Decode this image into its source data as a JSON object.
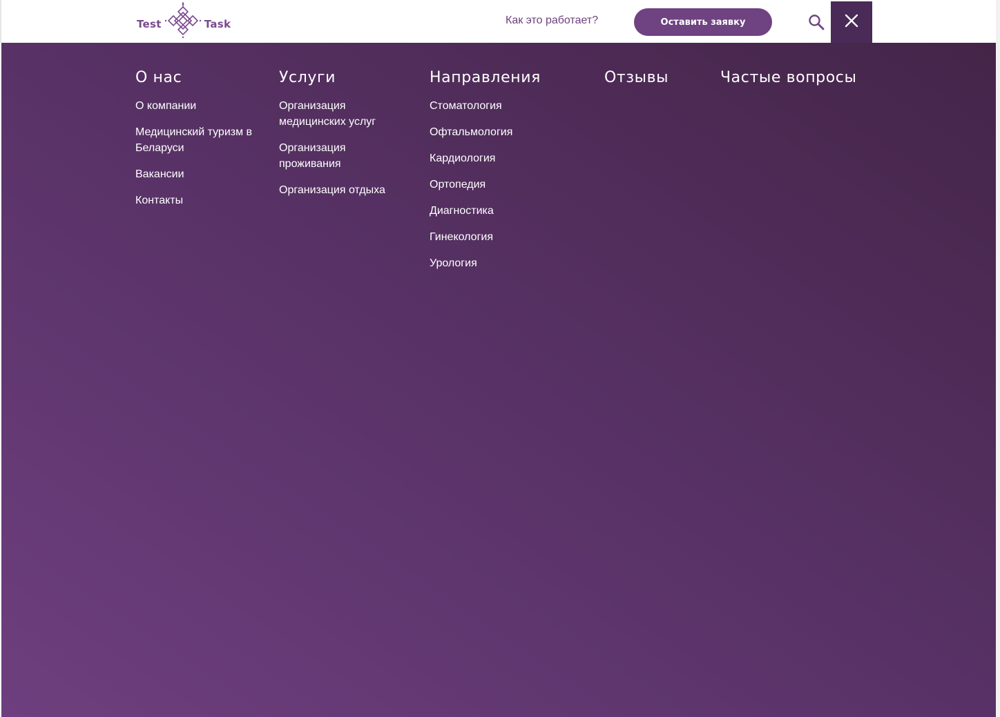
{
  "header": {
    "logo": {
      "left_text": "Test",
      "right_text": "Task",
      "icon": "diamond-ornament-logo-icon"
    },
    "how_it_works_link": "Как это работает?",
    "cta_button": "Оставить заявку",
    "search_icon": "search-icon",
    "close_icon": "close-icon"
  },
  "menu": {
    "columns": [
      {
        "title": "О нас",
        "items": [
          "О компании",
          "Медицинский туризм в Беларуси",
          "Вакансии",
          "Контакты"
        ]
      },
      {
        "title": "Услуги",
        "items": [
          "Организация медицинских услуг",
          "Организация проживания",
          "Организация отдыха"
        ]
      },
      {
        "title": "Направления",
        "items": [
          "Стоматология",
          "Офтальмология",
          "Кардиология",
          "Ортопедия",
          "Диагностика",
          "Гинекология",
          "Урология"
        ]
      },
      {
        "title": "Отзывы",
        "items": []
      },
      {
        "title": "Частые вопросы",
        "items": []
      }
    ]
  },
  "colors": {
    "brand": "#6f4282",
    "close_button_bg": "#4a2a57",
    "menu_gradient_start": "#6e3f7e",
    "menu_gradient_end": "#442548"
  }
}
